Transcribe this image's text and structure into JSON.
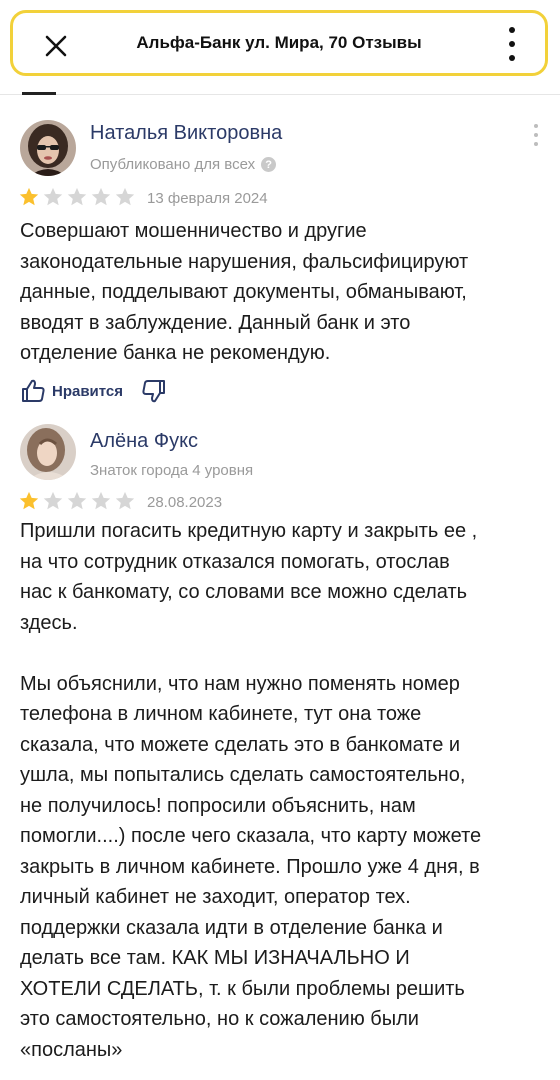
{
  "header": {
    "title": "Альфа-Банк ул. Мира, 70 Отзывы"
  },
  "reviews": [
    {
      "author": "Наталья Викторовна",
      "subtitle": "Опубликовано для всех",
      "rating": 1,
      "max_rating": 5,
      "date": "13 февраля 2024",
      "text": "Совершают мошенничество и другие\nзаконодательные нарушения, фальсифицируют\nданные, подделывают документы, обманывают,\nвводят в заблуждение. Данный банк и это\nотделение банка не рекомендую.",
      "like_label": "Нравится"
    },
    {
      "author": "Алёна Фукс",
      "subtitle": "Знаток города 4 уровня",
      "rating": 1,
      "max_rating": 5,
      "date": "28.08.2023",
      "text": "Пришли погасить кредитную карту и закрыть ее ,\nна что сотрудник отказался помогать, отослав\nнас к банкомату, со словами все можно сделать\nздесь.\n\nМы объяснили, что нам нужно поменять номер\nтелефона в личном кабинете, тут она тоже\nсказала, что можете сделать это в банкомате и\nушла, мы попытались сделать самостоятельно,\nне получилось! попросили объяснить, нам\nпомогли....) после чего сказала, что карту можете\nзакрыть в личном кабинете. Прошло уже 4 дня, в\nличный кабинет не заходит, оператор тех.\nподдержки сказала идти в отделение банка и\nделать все там. КАК МЫ ИЗНАЧАЛЬНО И\nХОТЕЛИ СДЕЛАТЬ, т. к были проблемы решить\nэто самостоятельно, но к сожалению были\n«посланы»"
    }
  ],
  "colors": {
    "accent_border": "#f2d13a",
    "star_filled": "#fbc02d",
    "star_empty": "#d6d6d6",
    "author": "#2b3a67"
  },
  "icons": [
    "close-icon",
    "more-vertical-icon",
    "help-icon",
    "star-icon",
    "thumb-up-icon",
    "thumb-down-icon"
  ]
}
